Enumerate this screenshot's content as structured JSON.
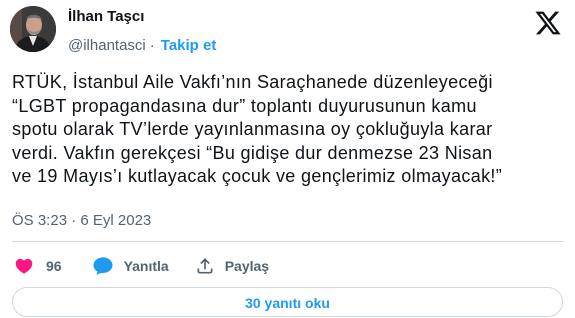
{
  "author": {
    "name": "İlhan Taşcı",
    "handle": "@ilhantasci",
    "separator": "·",
    "follow_label": "Takip et"
  },
  "tweet": {
    "text": "RTÜK, İstanbul Aile Vakfı’nın Saraçhanede düzenleyeceği\n“LGBT propagandasına dur” toplantı duyurusunun kamu\nspotu olarak TV’lerde yayınlanmasına oy çokluğuyla karar\nverdi. Vakfın gerekçesi “Bu gidişe dur denmezse 23 Nisan\nve 19 Mayıs’ı kutlayacak çocuk ve gençlerimiz olmayacak!”",
    "timestamp": "ÖS 3:23 · 6 Eyl 2023"
  },
  "actions": {
    "like_count": "96",
    "reply_label": "Yanıtla",
    "share_label": "Paylaş"
  },
  "replies_button_label": "30 yanıtı oku",
  "colors": {
    "like": "#f91880",
    "accent": "#1d9bf0",
    "secondary_text": "#536471"
  },
  "icons": [
    "x-logo-icon",
    "heart-icon",
    "reply-bubble-icon",
    "share-icon"
  ]
}
